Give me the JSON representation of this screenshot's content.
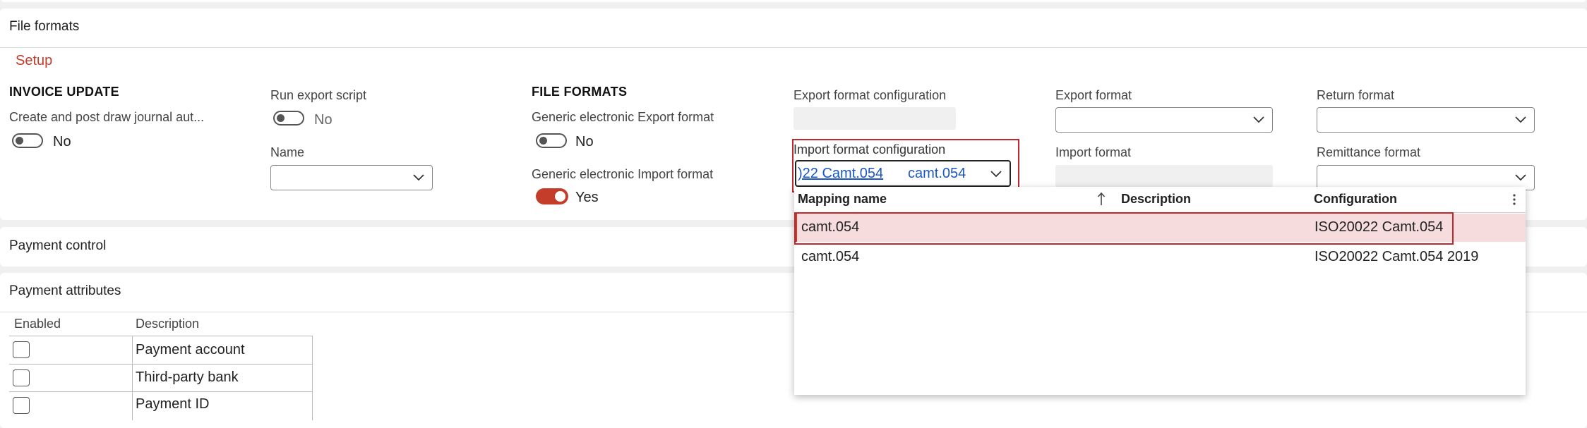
{
  "file_formats": {
    "title": "File formats",
    "setup_link": "Setup",
    "invoice_update": {
      "heading": "INVOICE UPDATE",
      "create_post_label": "Create and post draw journal aut...",
      "create_post_value": "No"
    },
    "run_export": {
      "label": "Run export script",
      "value": "No",
      "name_label": "Name"
    },
    "file_formats_group": {
      "heading": "FILE FORMATS",
      "export_label": "Generic electronic Export format",
      "export_value": "No",
      "import_label": "Generic electronic Import format",
      "import_value": "Yes"
    },
    "export_format_configuration": {
      "label": "Export format configuration"
    },
    "import_format_configuration": {
      "label": "Import format configuration",
      "value_configuration": ")22 Camt.054",
      "value_mapping": "camt.054"
    },
    "export_format": {
      "label": "Export format"
    },
    "import_format": {
      "label": "Import format"
    },
    "return_format": {
      "label": "Return format"
    },
    "remittance_format": {
      "label": "Remittance format"
    }
  },
  "dropdown": {
    "columns": {
      "mapping_name": "Mapping name",
      "description": "Description",
      "configuration": "Configuration"
    },
    "sort_icon": "arrow-up-icon",
    "more_icon": "more-vertical-icon",
    "rows": [
      {
        "mapping_name": "camt.054",
        "description": "",
        "configuration": "ISO20022 Camt.054",
        "selected": true
      },
      {
        "mapping_name": "camt.054",
        "description": "",
        "configuration": "ISO20022 Camt.054 2019",
        "selected": false
      }
    ]
  },
  "payment_control": {
    "title": "Payment control"
  },
  "payment_attributes": {
    "title": "Payment attributes",
    "columns": {
      "enabled": "Enabled",
      "description": "Description"
    },
    "rows": [
      {
        "enabled": false,
        "description": "Payment account"
      },
      {
        "enabled": false,
        "description": "Third-party bank"
      },
      {
        "enabled": false,
        "description": "Payment ID"
      }
    ]
  },
  "colors": {
    "accent_red": "#c33d2a",
    "link_blue": "#1a56c4",
    "selected_row": "#f6dcdc",
    "highlight_border": "#c0282d"
  }
}
